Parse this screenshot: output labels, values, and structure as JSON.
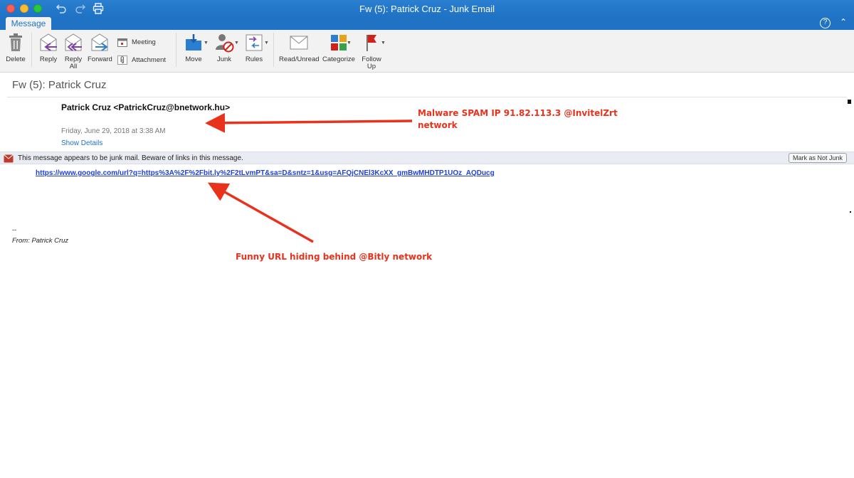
{
  "window": {
    "title": "Fw (5): Patrick Cruz - Junk Email"
  },
  "ribbon": {
    "tab": "Message",
    "help": "?",
    "buttons": {
      "delete": "Delete",
      "reply": "Reply",
      "reply_all_line1": "Reply",
      "reply_all_line2": "All",
      "forward": "Forward",
      "meeting": "Meeting",
      "attachment": "Attachment",
      "move": "Move",
      "junk": "Junk",
      "rules": "Rules",
      "read_unread": "Read/Unread",
      "categorize": "Categorize",
      "follow_up_line1": "Follow",
      "follow_up_line2": "Up"
    }
  },
  "message": {
    "subject": "Fw (5): Patrick Cruz",
    "sender": "Patrick Cruz <PatrickCruz@bnetwork.hu>",
    "date": "Friday, June 29, 2018 at 3:38 AM",
    "show_details": "Show Details",
    "junk_warning": "This message appears to be junk mail. Beware of links in this message.",
    "mark_not_junk": "Mark as Not Junk",
    "link": "https://www.google.com/url?q=https%3A%2F%2Fbit.ly%2F2tLvmPT&sa=D&sntz=1&usg=AFQjCNEl3KcXX_gmBwMHDTP1UOz_AQDucg",
    "signature_dash": "--",
    "signature_from": "From: Patrick Cruz"
  },
  "annotations": {
    "spam_ip_line1": "Malware SPAM IP 91.82.113.3 @InvitelZrt",
    "spam_ip_line2": "network",
    "funny_url": "Funny URL hiding behind @Bitly network"
  },
  "colors": {
    "accent": "#1f72c4",
    "annotation": "#e8321c",
    "link": "#1f3fd6"
  }
}
